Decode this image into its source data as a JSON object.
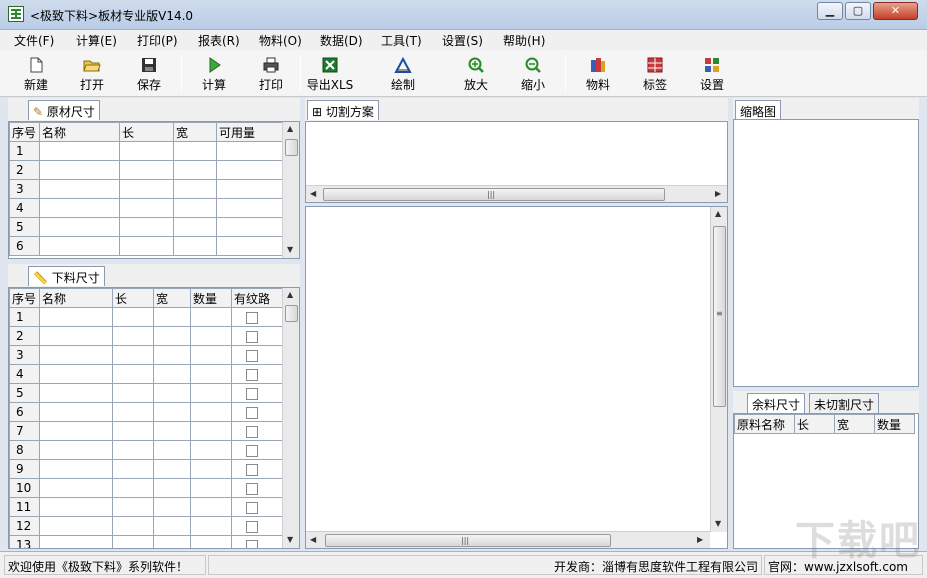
{
  "window": {
    "title": "<极致下料>板材专业版V14.0",
    "minimize_glyph": "▁",
    "maximize_glyph": "▢",
    "close_glyph": "✕"
  },
  "menu": [
    "文件(F)",
    "计算(E)",
    "打印(P)",
    "报表(R)",
    "物料(O)",
    "数据(D)",
    "工具(T)",
    "设置(S)",
    "帮助(H)"
  ],
  "toolbar": {
    "new": "新建",
    "open": "打开",
    "save": "保存",
    "calc": "计算",
    "print": "打印",
    "export": "导出XLS",
    "draw": "绘制",
    "zoom_in": "放大",
    "zoom_out": "缩小",
    "material": "物料",
    "label": "标签",
    "settings": "设置",
    "dropdown_glyph": "▼"
  },
  "raw_panel": {
    "tab": "原材尺寸",
    "columns": [
      "序号",
      "名称",
      "长",
      "宽",
      "可用量"
    ],
    "rows": [
      "1",
      "2",
      "3",
      "4",
      "5",
      "6"
    ]
  },
  "cut_panel": {
    "tab": "下料尺寸",
    "columns": [
      "序号",
      "名称",
      "长",
      "宽",
      "数量",
      "有纹路"
    ],
    "rows": [
      "1",
      "2",
      "3",
      "4",
      "5",
      "6",
      "7",
      "8",
      "9",
      "10",
      "11",
      "12",
      "13"
    ]
  },
  "plan_panel": {
    "tab": "切割方案"
  },
  "thumb_panel": {
    "tab": "缩略图"
  },
  "leftover_panel": {
    "tab_leftover": "余料尺寸",
    "tab_uncut": "未切割尺寸",
    "columns": [
      "原料名称",
      "长",
      "宽",
      "数量"
    ]
  },
  "scroll": {
    "up": "▲",
    "down": "▼",
    "left": "◀",
    "right": "▶",
    "grip_h": "|||",
    "grip_v": "≡"
  },
  "status": {
    "welcome": "欢迎使用《极致下料》系列软件！",
    "developer": "开发商：淄博有思度软件工程有限公司",
    "website": "官网：www.jzxlsoft.com"
  },
  "watermark": "下载吧",
  "colors": {
    "accent": "#2b8a2b",
    "panel_border": "#8a9ab0",
    "title_bg": "#c4d6ec"
  }
}
